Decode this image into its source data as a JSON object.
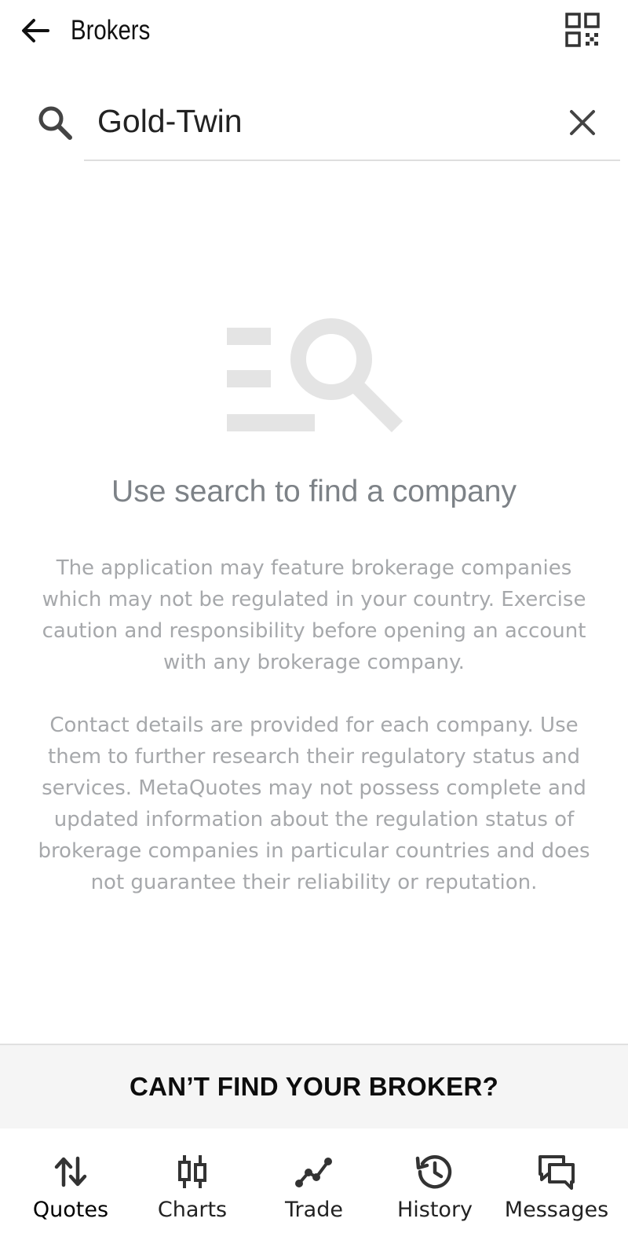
{
  "app_bar": {
    "title": "Brokers",
    "back_icon": "arrow-left-icon",
    "qr_icon": "qr-code-icon"
  },
  "search": {
    "value": "Gold-Twin",
    "search_icon": "search-icon",
    "clear_icon": "close-icon"
  },
  "empty_state": {
    "icon": "search-list-icon",
    "title": "Use search to find a company",
    "disclaimer_1": "The application may feature brokerage companies which may not be regulated in your country. Exercise caution and responsibility before opening an account with any brokerage company.",
    "disclaimer_2": "Contact details are provided for each company. Use them to further research their regulatory status and services. MetaQuotes may not possess complete and updated information about the regulation status of brokerage companies in particular countries and does not guarantee their reliability or reputation."
  },
  "cant_find": {
    "label": "CAN’T FIND YOUR BROKER?"
  },
  "bottom_nav": {
    "items": [
      {
        "label": "Quotes",
        "icon": "quotes-arrows-icon",
        "active": true
      },
      {
        "label": "Charts",
        "icon": "candlestick-icon",
        "active": false
      },
      {
        "label": "Trade",
        "icon": "trend-line-icon",
        "active": false
      },
      {
        "label": "History",
        "icon": "history-clock-icon",
        "active": false
      },
      {
        "label": "Messages",
        "icon": "chat-bubbles-icon",
        "active": false
      }
    ]
  },
  "colors": {
    "title_gray": "#7d8287",
    "body_gray": "#a6a8ab",
    "illustration_gray": "#e4e4e4",
    "bar_bg": "#f5f5f5"
  }
}
